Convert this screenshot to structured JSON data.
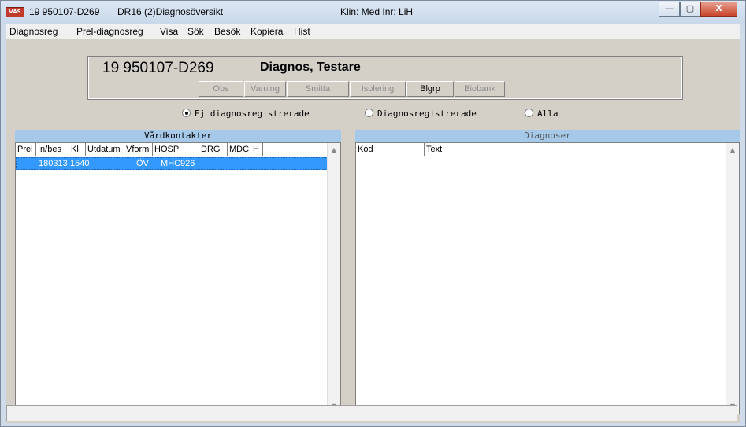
{
  "window": {
    "icon_text": "VAS",
    "title_id": "19 950107-D269",
    "title_app": "DR16 (2)Diagnosöversikt",
    "title_klin": "Klin: Med  Inr: LiH",
    "minimize": "—",
    "maximize": "▢",
    "close": "X"
  },
  "menu": {
    "items": [
      {
        "label": "Diagnosreg"
      },
      {
        "label": "Prel-diagnosreg"
      },
      {
        "label": "Visa"
      },
      {
        "label": "Sök"
      },
      {
        "label": "Besök"
      },
      {
        "label": "Kopiera"
      },
      {
        "label": "Hist"
      }
    ]
  },
  "patient": {
    "id": "19 950107-D269",
    "name": "Diagnos, Testare",
    "buttons": {
      "obs": "Obs",
      "varning": "Varning",
      "smitta": "Smitta",
      "isolering": "Isolering",
      "blgrp": "Blgrp",
      "biobank": "Biobank"
    }
  },
  "filter": {
    "ej": "Ej diagnosregistrerade",
    "diag": "Diagnosregistrerade",
    "alla": "Alla",
    "selected": "Ej diagnosregistrerade"
  },
  "vardkontakter": {
    "title": "Vårdkontakter",
    "columns": {
      "prel": "Prel",
      "inbes": "In/bes",
      "kl": "Kl",
      "utdatum": "Utdatum",
      "vform": "Vform",
      "hosp": "HOSP",
      "drg": "DRG",
      "mdc": "MDC",
      "h": "H"
    },
    "rows": [
      {
        "prel": "",
        "inbes": "180313",
        "kl": "1540",
        "utdatum": "",
        "vform": "ÖV",
        "hosp": "MHC926",
        "drg": "",
        "mdc": "",
        "h": ""
      }
    ]
  },
  "diagnoser": {
    "title": "Diagnoser",
    "columns": {
      "kod": "Kod",
      "text": "Text"
    }
  },
  "colors": {
    "selection": "#3399ff",
    "panel_header": "#a6c9ea",
    "face": "#d4d0c8"
  }
}
